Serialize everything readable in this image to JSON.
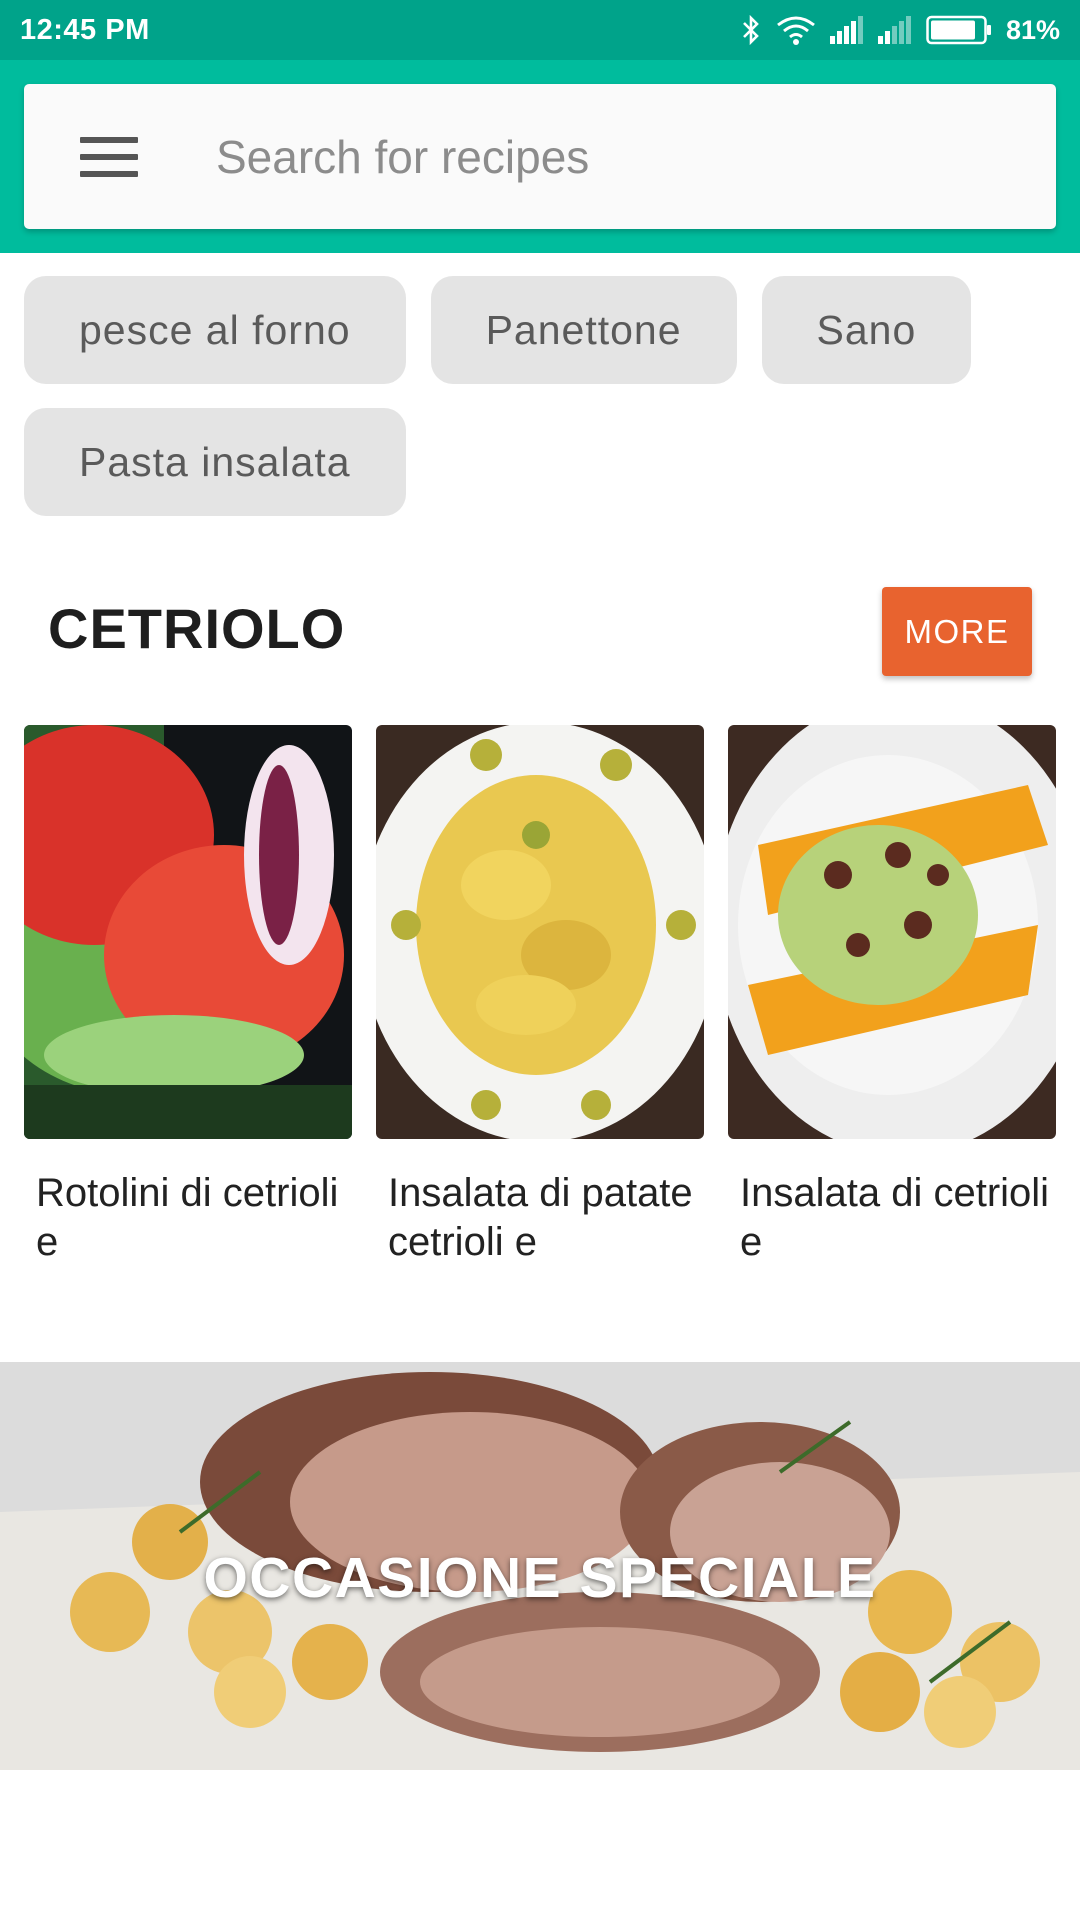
{
  "status_bar": {
    "time": "12:45 PM",
    "battery": "81%",
    "icons": [
      "bluetooth-icon",
      "wifi-icon",
      "signal-icon",
      "signal-weak-icon",
      "battery-icon"
    ]
  },
  "search": {
    "placeholder": "Search for recipes",
    "menu_icon": "hamburger-menu-icon"
  },
  "chips": [
    "pesce al forno",
    "Panettone",
    "Sano",
    "Pasta insalata"
  ],
  "section": {
    "title": "CETRIOLO",
    "more_label": "MORE"
  },
  "recipes": [
    {
      "title": "Rotolini di cetrioli e"
    },
    {
      "title": "Insalata di patate cetrioli e"
    },
    {
      "title": "Insalata di cetrioli e"
    }
  ],
  "banner": {
    "title": "OCCASIONE SPECIALE"
  },
  "colors": {
    "status_bar": "#00a38a",
    "app_bar": "#00bc9d",
    "chip_bg": "#e4e4e4",
    "more_button": "#e8632f"
  }
}
